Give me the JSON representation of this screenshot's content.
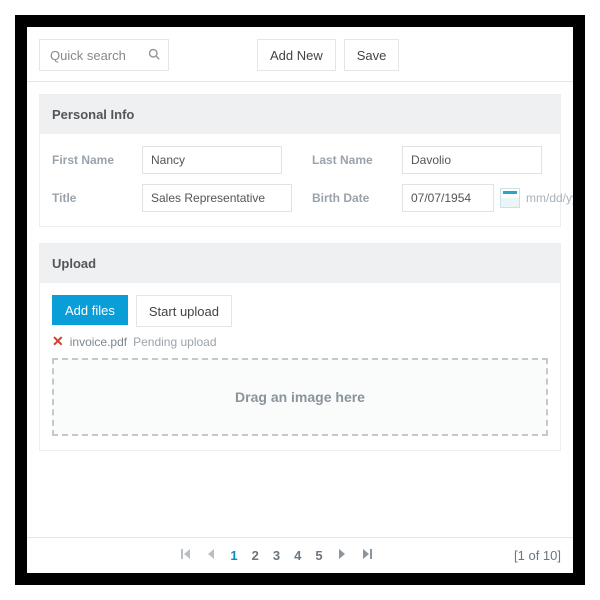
{
  "toolbar": {
    "search_placeholder": "Quick search",
    "add_new_label": "Add New",
    "save_label": "Save"
  },
  "personal_info_panel": {
    "title": "Personal Info",
    "first_name_label": "First Name",
    "first_name_value": "Nancy",
    "last_name_label": "Last Name",
    "last_name_value": "Davolio",
    "title_label": "Title",
    "title_value": "Sales Representative",
    "birth_date_label": "Birth Date",
    "birth_date_value": "07/07/1954",
    "date_hint": "mm/dd/yyyy"
  },
  "upload_panel": {
    "title": "Upload",
    "add_files_label": "Add files",
    "start_upload_label": "Start upload",
    "file_name": "invoice.pdf",
    "file_status": "Pending upload",
    "dropzone_text": "Drag an image here"
  },
  "pager": {
    "pages": [
      "1",
      "2",
      "3",
      "4",
      "5"
    ],
    "active_index": 0,
    "status_text": "[1 of 10]"
  }
}
